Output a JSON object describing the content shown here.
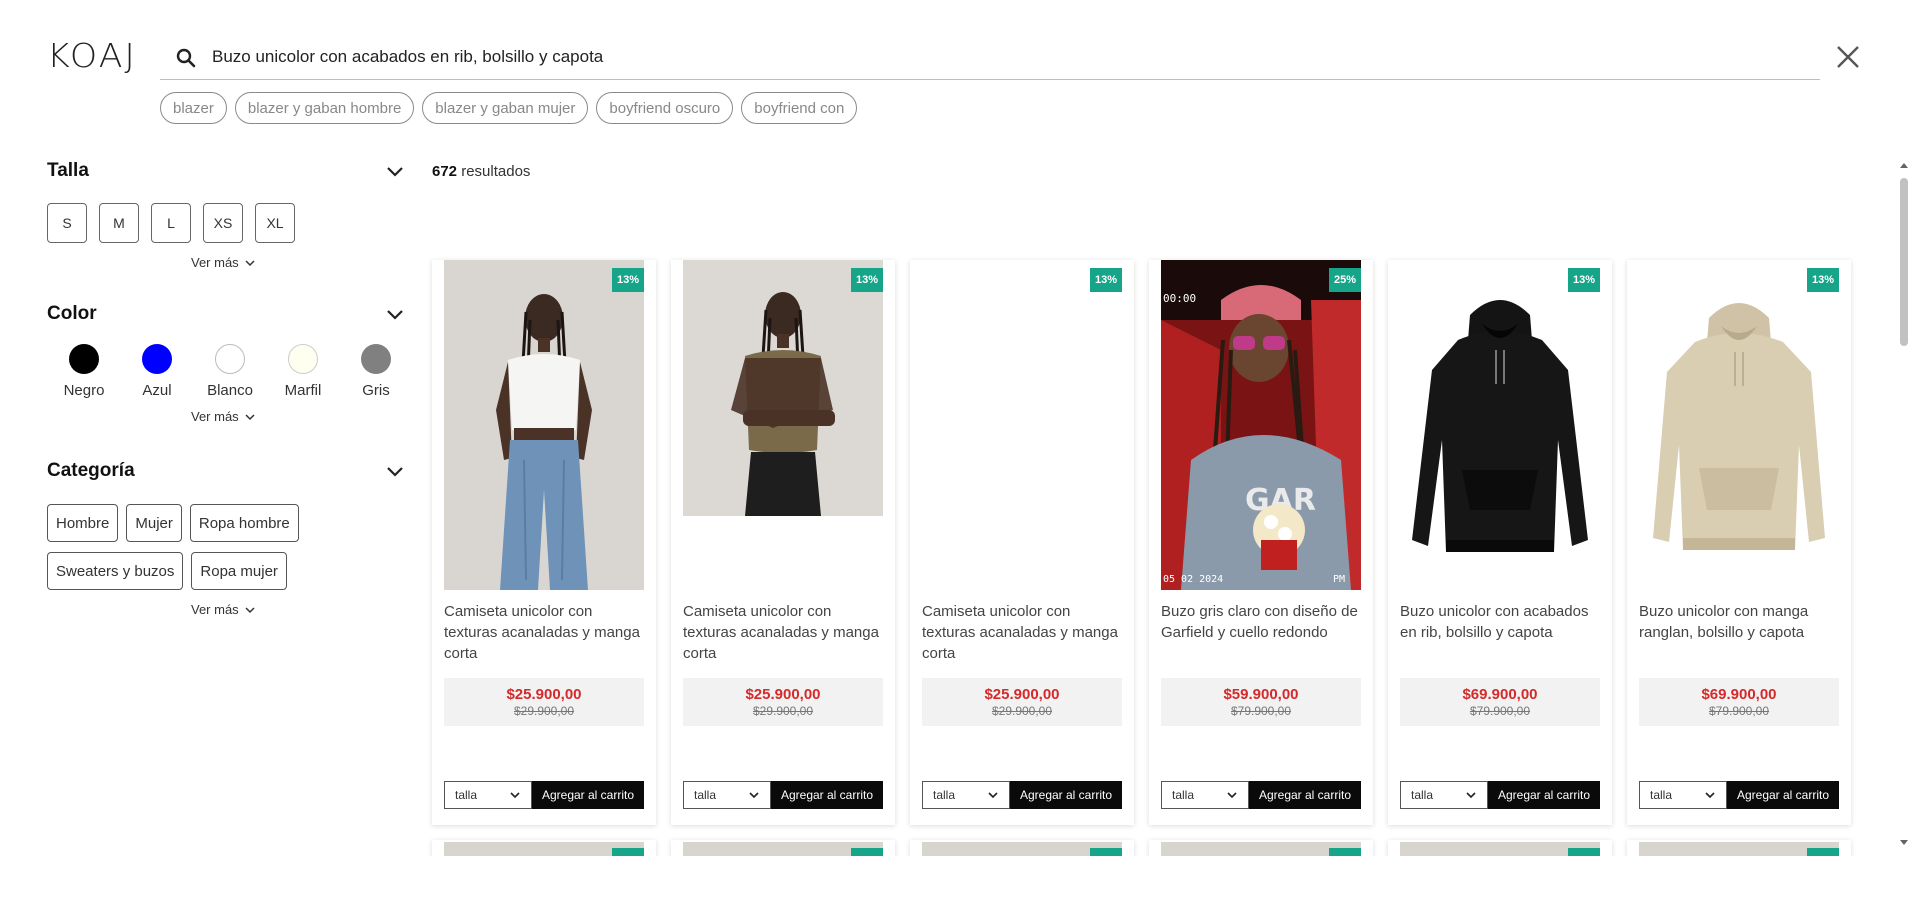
{
  "brand": {
    "logo_text": "KOAJ"
  },
  "search": {
    "value": "Buzo unicolor con acabados en rib, bolsillo y capota",
    "suggestions": [
      "blazer",
      "blazer y gaban hombre",
      "blazer y gaban mujer",
      "boyfriend oscuro",
      "boyfriend con"
    ]
  },
  "icons": {
    "search": "search-icon",
    "close": "close-icon",
    "chevron": "chevron-down-icon"
  },
  "filters": {
    "talla": {
      "title": "Talla",
      "options": [
        "S",
        "M",
        "L",
        "XS",
        "XL"
      ],
      "ver_mas": "Ver más"
    },
    "color": {
      "title": "Color",
      "options": [
        {
          "label": "Negro",
          "hex": "#000000"
        },
        {
          "label": "Azul",
          "hex": "#0000ff"
        },
        {
          "label": "Blanco",
          "hex": "#ffffff"
        },
        {
          "label": "Marfil",
          "hex": "#fffff0"
        },
        {
          "label": "Gris",
          "hex": "#808080"
        }
      ],
      "ver_mas": "Ver más"
    },
    "categoria": {
      "title": "Categoría",
      "options": [
        "Hombre",
        "Mujer",
        "Ropa hombre",
        "Sweaters y buzos",
        "Ropa mujer"
      ],
      "ver_mas": "Ver más"
    }
  },
  "results": {
    "count": "672",
    "label": " resultados"
  },
  "products": [
    {
      "name": "Camiseta unicolor con texturas acanaladas y manga corta",
      "discount": "13%",
      "price": "$25.900,00",
      "old_price": "$29.900,00",
      "talla_label": "talla",
      "cart_label": "Agregar al carrito"
    },
    {
      "name": "Camiseta unicolor con texturas acanaladas y manga corta",
      "discount": "13%",
      "price": "$25.900,00",
      "old_price": "$29.900,00",
      "talla_label": "talla",
      "cart_label": "Agregar al carrito"
    },
    {
      "name": "Camiseta unicolor con texturas acanaladas y manga corta",
      "discount": "13%",
      "price": "$25.900,00",
      "old_price": "$29.900,00",
      "talla_label": "talla",
      "cart_label": "Agregar al carrito"
    },
    {
      "name": "Buzo gris claro con diseño de Garfield y cuello redondo",
      "discount": "25%",
      "price": "$59.900,00",
      "old_price": "$79.900,00",
      "talla_label": "talla",
      "cart_label": "Agregar al carrito"
    },
    {
      "name": "Buzo unicolor con acabados en rib, bolsillo y capota",
      "discount": "13%",
      "price": "$69.900,00",
      "old_price": "$79.900,00",
      "talla_label": "talla",
      "cart_label": "Agregar al carrito"
    },
    {
      "name": "Buzo unicolor con manga ranglan, bolsillo y capota",
      "discount": "13%",
      "price": "$69.900,00",
      "old_price": "$79.900,00",
      "talla_label": "talla",
      "cart_label": "Agregar al carrito"
    }
  ],
  "colors": {
    "accent": "#17a589",
    "price_red": "#d42a2a",
    "button_black": "#0a0a0a"
  }
}
